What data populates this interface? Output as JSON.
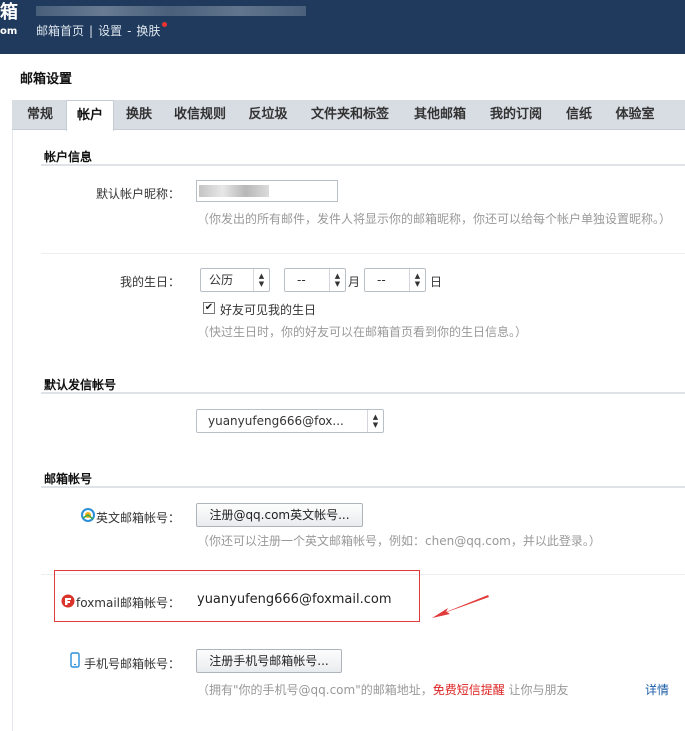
{
  "header": {
    "brand": "箱",
    "brand_sub": "om",
    "links": [
      "邮箱首页",
      "设置",
      "换肤"
    ]
  },
  "settings": {
    "title": "邮箱设置",
    "tabs": [
      "常规",
      "帐户",
      "换肤",
      "收信规则",
      "反垃圾",
      "文件夹和标签",
      "其他邮箱",
      "我的订阅",
      "信纸",
      "体验室"
    ],
    "active_tab": "帐户"
  },
  "account_info": {
    "heading": "帐户信息",
    "nickname_label": "默认帐户昵称：",
    "nickname_hint": "（你发出的所有邮件，发件人将显示你的邮箱昵称，你还可以给每个帐户单独设置昵称。）",
    "birthday_label": "我的生日：",
    "calendar_value": "公历",
    "month_value": "--",
    "month_unit": "月",
    "day_value": "--",
    "day_unit": "日",
    "friends_visible_label": "好友可见我的生日",
    "friends_visible_checked": true,
    "birthday_hint": "（快过生日时，你的好友可以在邮箱首页看到你的生日信息。）"
  },
  "default_sender": {
    "heading": "默认发信帐号",
    "selected": "yuanyufeng666@fox..."
  },
  "mail_accounts": {
    "heading": "邮箱帐号",
    "english_label": "英文邮箱帐号：",
    "english_button": "注册@qq.com英文帐号...",
    "english_hint": "（你还可以注册一个英文邮箱帐号，例如：chen@qq.com，并以此登录。）",
    "foxmail_label": "foxmail邮箱帐号：",
    "foxmail_value": "yuanyufeng666@foxmail.com",
    "mobile_label": "手机号邮箱帐号：",
    "mobile_button": "注册手机号邮箱帐号...",
    "mobile_hint_a": "（拥有\"你的手机号@qq.com\"的邮箱地址，",
    "mobile_hint_red": "免费短信提醒",
    "mobile_hint_b": " 让你与朋友",
    "details_link": "详情"
  },
  "colors": {
    "header_bg": "#1f3a5c",
    "highlight": "#e23b3b",
    "arrow": "#e23b3b"
  },
  "icons": [
    "english-account-icon",
    "foxmail-icon",
    "mobile-phone-icon",
    "check-icon",
    "caret-icon",
    "red-arrow-icon"
  ]
}
